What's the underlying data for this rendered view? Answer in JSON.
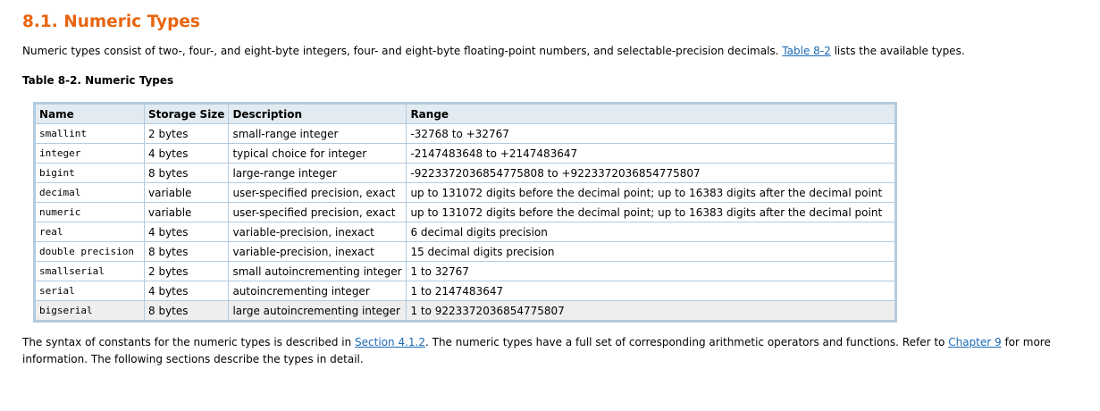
{
  "heading": "8.1. Numeric Types",
  "intro": {
    "before": "Numeric types consist of two-, four-, and eight-byte integers, four- and eight-byte floating-point numbers, and selectable-precision decimals. ",
    "link": "Table 8-2",
    "after": " lists the available types."
  },
  "table": {
    "caption": "Table 8-2. Numeric Types",
    "headers": [
      "Name",
      "Storage Size",
      "Description",
      "Range"
    ],
    "rows": [
      [
        "smallint",
        "2 bytes",
        "small-range integer",
        "-32768 to +32767"
      ],
      [
        "integer",
        "4 bytes",
        "typical choice for integer",
        "-2147483648 to +2147483647"
      ],
      [
        "bigint",
        "8 bytes",
        "large-range integer",
        "-9223372036854775808 to +9223372036854775807"
      ],
      [
        "decimal",
        "variable",
        "user-specified precision, exact",
        "up to 131072 digits before the decimal point; up to 16383 digits after the decimal point"
      ],
      [
        "numeric",
        "variable",
        "user-specified precision, exact",
        "up to 131072 digits before the decimal point; up to 16383 digits after the decimal point"
      ],
      [
        "real",
        "4 bytes",
        "variable-precision, inexact",
        "6 decimal digits precision"
      ],
      [
        "double precision",
        "8 bytes",
        "variable-precision, inexact",
        "15 decimal digits precision"
      ],
      [
        "smallserial",
        "2 bytes",
        "small autoincrementing integer",
        "1 to 32767"
      ],
      [
        "serial",
        "4 bytes",
        "autoincrementing integer",
        "1 to 2147483647"
      ],
      [
        "bigserial",
        "8 bytes",
        "large autoincrementing integer",
        "1 to 9223372036854775807"
      ]
    ]
  },
  "outro": {
    "t1": "The syntax of constants for the numeric types is described in ",
    "link1": "Section 4.1.2",
    "t2": ". The numeric types have a full set of corresponding arithmetic operators and functions. Refer to ",
    "link2": "Chapter 9",
    "t3": " for more information. The following sections describe the types in detail."
  }
}
